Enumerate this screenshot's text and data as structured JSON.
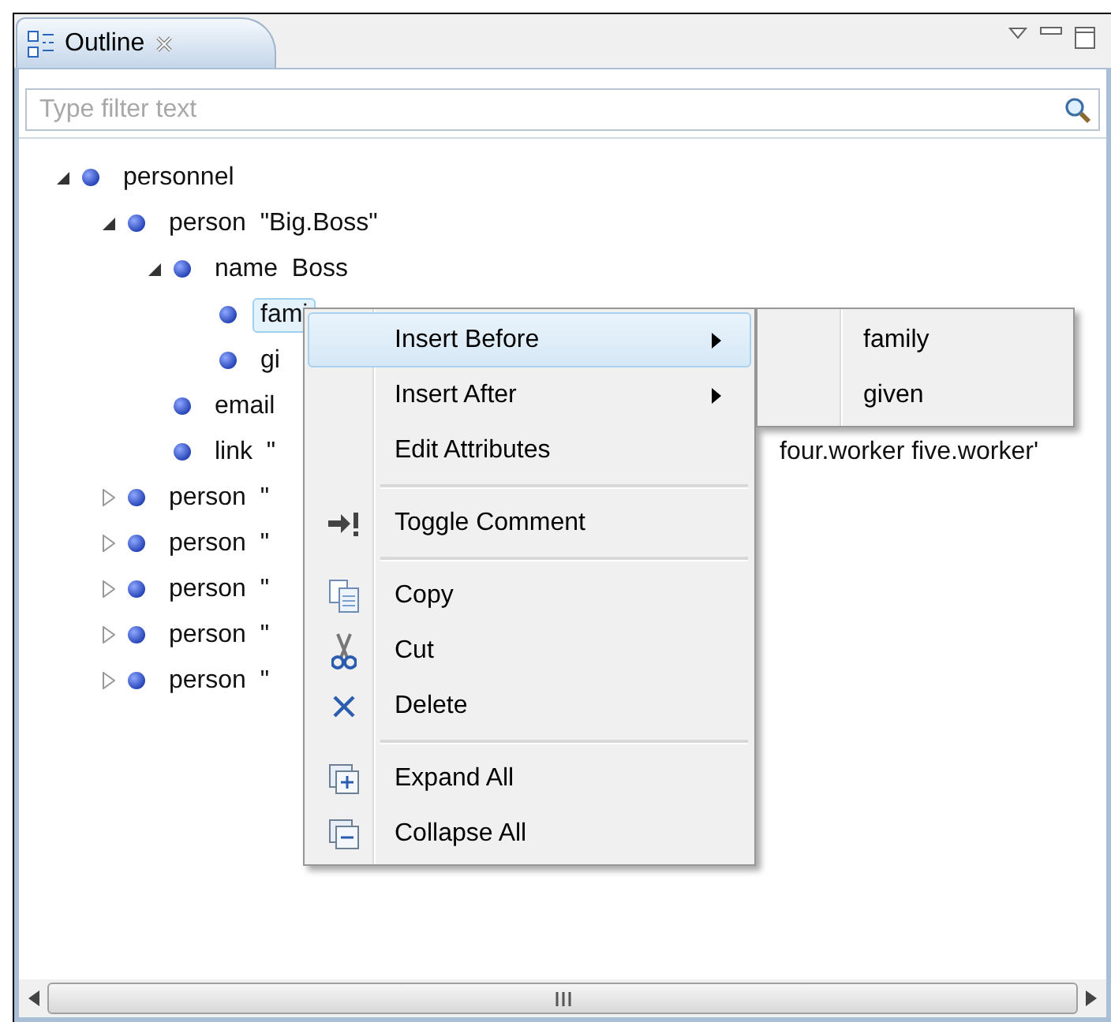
{
  "view": {
    "tab": {
      "title": "Outline",
      "selected": true
    },
    "filter": {
      "placeholder": "Type filter text"
    },
    "tree": [
      {
        "label": "personnel",
        "expanded": true,
        "selected": false,
        "children": [
          {
            "label": "person  \"Big.Boss\"",
            "expanded": true,
            "selected": false,
            "children": [
              {
                "label": "name  Boss",
                "expanded": true,
                "selected": false,
                "children": [
                  {
                    "label": "fami",
                    "selected": true
                  },
                  {
                    "label": "gi",
                    "selected": false
                  }
                ]
              },
              {
                "label": "email",
                "selected": false
              },
              {
                "label": "link  \"",
                "tail": "four.worker five.worker'",
                "selected": false
              }
            ]
          },
          {
            "label": "person  \"",
            "expanded": false,
            "selected": false
          },
          {
            "label": "person  \"",
            "expanded": false,
            "selected": false
          },
          {
            "label": "person  \"",
            "expanded": false,
            "selected": false
          },
          {
            "label": "person  \"",
            "expanded": false,
            "selected": false
          },
          {
            "label": "person  \"",
            "expanded": false,
            "selected": false
          }
        ]
      }
    ]
  },
  "context_menu": {
    "items": [
      {
        "kind": "submenu",
        "label": "Insert Before",
        "selected": true
      },
      {
        "kind": "submenu",
        "label": "Insert After",
        "selected": false
      },
      {
        "kind": "plain",
        "label": "Edit Attributes",
        "selected": false
      },
      {
        "kind": "separator"
      },
      {
        "kind": "toggle",
        "label": "Toggle Comment",
        "selected": false
      },
      {
        "kind": "separator"
      },
      {
        "kind": "copy",
        "label": "Copy",
        "selected": false
      },
      {
        "kind": "cut",
        "label": "Cut",
        "selected": false
      },
      {
        "kind": "delete",
        "label": "Delete",
        "selected": false
      },
      {
        "kind": "separator"
      },
      {
        "kind": "expand",
        "label": "Expand All",
        "selected": false
      },
      {
        "kind": "collapse",
        "label": "Collapse All",
        "selected": false
      }
    ]
  },
  "submenu": {
    "items": [
      {
        "label": "family",
        "selected": false
      },
      {
        "label": "given",
        "selected": false
      }
    ]
  }
}
